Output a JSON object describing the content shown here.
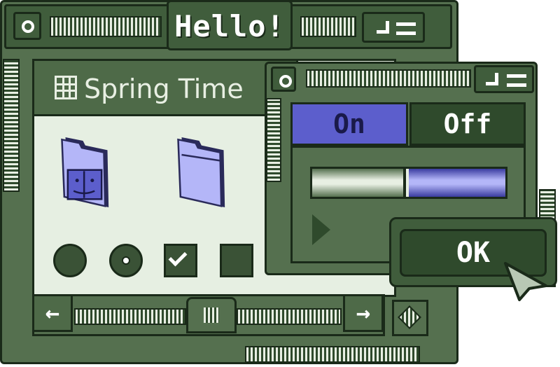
{
  "window": {
    "title": "Hello!",
    "header_text": "Spring Time"
  },
  "panel": {
    "tabs": [
      {
        "label": "On",
        "selected": true
      },
      {
        "label": "Off",
        "selected": false
      }
    ],
    "slider_value_fraction": 0.48
  },
  "dialog": {
    "ok_label": "OK"
  },
  "controls": {
    "radio_1_selected": false,
    "radio_2_selected": true,
    "checkbox_1_checked": true,
    "checkbox_2_checked": false
  },
  "scroll_glyphs": {
    "left": "←",
    "right": "→"
  },
  "colors": {
    "chrome": "#55704f",
    "accent": "#5c5ecc",
    "folder": "#b4b6f8"
  },
  "icons": [
    "grid-icon",
    "finder-folder-icon",
    "folder-icon",
    "play-arrow-icon",
    "pointer-cursor-icon"
  ]
}
